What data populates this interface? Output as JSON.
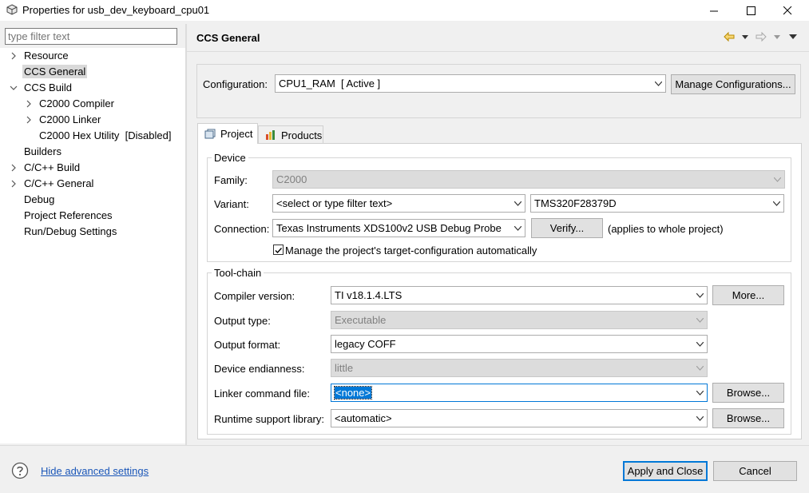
{
  "window": {
    "title": "Properties for usb_dev_keyboard_cpu01",
    "minimize_glyph": "—",
    "maximize_glyph": "☐",
    "close_glyph": "✕"
  },
  "sidebar": {
    "filter_placeholder": "type filter text",
    "items": [
      {
        "label": "Resource",
        "twisty": "collapsed",
        "level": 0,
        "selected": false
      },
      {
        "label": "CCS General",
        "twisty": "none",
        "level": 0,
        "selected": true
      },
      {
        "label": "CCS Build",
        "twisty": "expanded",
        "level": 0,
        "selected": false
      },
      {
        "label": "C2000 Compiler",
        "twisty": "collapsed",
        "level": 1,
        "selected": false
      },
      {
        "label": "C2000 Linker",
        "twisty": "collapsed",
        "level": 1,
        "selected": false
      },
      {
        "label": "C2000 Hex Utility  [Disabled]",
        "twisty": "none",
        "level": 1,
        "selected": false
      },
      {
        "label": "Builders",
        "twisty": "none",
        "level": 0,
        "selected": false
      },
      {
        "label": "C/C++ Build",
        "twisty": "collapsed",
        "level": 0,
        "selected": false
      },
      {
        "label": "C/C++ General",
        "twisty": "collapsed",
        "level": 0,
        "selected": false
      },
      {
        "label": "Debug",
        "twisty": "none",
        "level": 0,
        "selected": false
      },
      {
        "label": "Project References",
        "twisty": "none",
        "level": 0,
        "selected": false
      },
      {
        "label": "Run/Debug Settings",
        "twisty": "none",
        "level": 0,
        "selected": false
      }
    ]
  },
  "page": {
    "title": "CCS General"
  },
  "configuration": {
    "label": "Configuration:",
    "value": "CPU1_RAM  [ Active ]",
    "manage_button": "Manage Configurations..."
  },
  "tabs": [
    {
      "label": "Project",
      "active": true,
      "icon": "project-icon"
    },
    {
      "label": "Products",
      "active": false,
      "icon": "products-icon"
    }
  ],
  "device": {
    "legend": "Device",
    "family_label": "Family:",
    "family_value": "C2000",
    "variant_label": "Variant:",
    "variant_filter": "<select or type filter text>",
    "variant_value": "TMS320F28379D",
    "connection_label": "Connection:",
    "connection_value": "Texas Instruments XDS100v2 USB Debug Probe",
    "verify_button": "Verify...",
    "connection_note": "(applies to whole project)",
    "manage_target_label": "Manage the project's target-configuration automatically",
    "manage_target_checked": true
  },
  "toolchain": {
    "legend": "Tool-chain",
    "compiler_label": "Compiler version:",
    "compiler_value": "TI v18.1.4.LTS",
    "more_button": "More...",
    "output_type_label": "Output type:",
    "output_type_value": "Executable",
    "output_format_label": "Output format:",
    "output_format_value": "legacy COFF",
    "endianness_label": "Device endianness:",
    "endianness_value": "little",
    "linker_cmd_label": "Linker command file:",
    "linker_cmd_value": "<none>",
    "browse_label": "Browse...",
    "rts_label": "Runtime support library:",
    "rts_value": "<automatic>"
  },
  "footer": {
    "advanced_link": "Hide advanced settings",
    "apply_close_button": "Apply and Close",
    "cancel_button": "Cancel"
  }
}
